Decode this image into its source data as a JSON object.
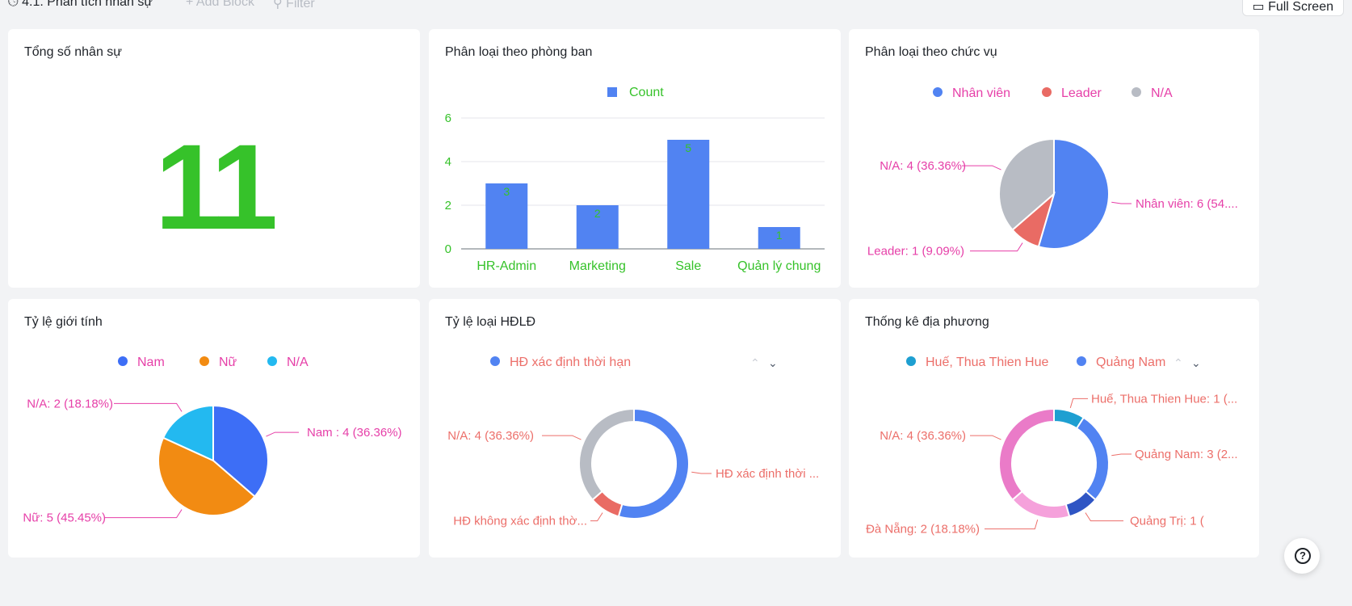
{
  "topbar": {
    "title": "4.1. Phân tích nhân sự",
    "add_block": "+ Add Block",
    "filter": "Filter",
    "full_screen": "Full Screen"
  },
  "cards": {
    "total": {
      "title": "Tổng số nhân sự",
      "value": "11"
    },
    "department": {
      "title": "Phân loại theo phòng ban"
    },
    "position": {
      "title": "Phân loại theo chức vụ"
    },
    "gender": {
      "title": "Tỷ lệ giới tính"
    },
    "contract": {
      "title": "Tỷ lệ loại HĐLĐ"
    },
    "region": {
      "title": "Thống kê địa phương"
    }
  },
  "chart_data": [
    {
      "type": "bar",
      "categories": [
        "HR-Admin",
        "Marketing",
        "Sale",
        "Quản lý chung"
      ],
      "series": [
        {
          "name": "Count",
          "values": [
            3,
            2,
            5,
            1
          ]
        }
      ],
      "ylim": [
        0,
        6
      ],
      "yticks": [
        0,
        2,
        4,
        6
      ],
      "legend": "top",
      "color": "#5183f2"
    },
    {
      "type": "pie",
      "legend": [
        "Nhân viên",
        "Leader",
        "N/A"
      ],
      "slices": [
        {
          "name": "Nhân viên",
          "value": 6,
          "label": "Nhân viên: 6 (54....",
          "color": "#5183f2"
        },
        {
          "name": "Leader",
          "value": 1,
          "label": "Leader: 1 (9.09%)",
          "color": "#e96b64"
        },
        {
          "name": "N/A",
          "value": 4,
          "label": "N/A: 4 (36.36%)",
          "color": "#b8bcc4"
        }
      ]
    },
    {
      "type": "pie",
      "legend": [
        "Nam",
        "Nữ",
        "N/A"
      ],
      "slices": [
        {
          "name": "Nam",
          "value": 4,
          "label": "Nam : 4 (36.36%)",
          "color": "#3d6ef6"
        },
        {
          "name": "Nữ",
          "value": 5,
          "label": "Nữ: 5 (45.45%)",
          "color": "#f28b12"
        },
        {
          "name": "N/A",
          "value": 2,
          "label": "N/A: 2 (18.18%)",
          "color": "#23b9f0"
        }
      ]
    },
    {
      "type": "pie",
      "donut": true,
      "legend": [
        "HĐ xác định thời hạn"
      ],
      "slices": [
        {
          "name": "HĐ xác định thời hạn",
          "value": 6,
          "label": "HĐ xác định thời ...",
          "color": "#5183f2"
        },
        {
          "name": "HĐ không xác định thời hạn",
          "value": 1,
          "label": "HĐ không xác định thờ...",
          "color": "#e96b64"
        },
        {
          "name": "N/A",
          "value": 4,
          "label": "N/A: 4 (36.36%)",
          "color": "#b8bcc4"
        }
      ]
    },
    {
      "type": "pie",
      "donut": true,
      "legend": [
        "Huế, Thua Thien Hue",
        "Quảng Nam"
      ],
      "slices": [
        {
          "name": "Huế, Thua Thien Hue",
          "value": 1,
          "label": "Huế, Thua Thien Hue: 1 (...",
          "color": "#1e9fd1"
        },
        {
          "name": "Quảng Nam",
          "value": 3,
          "label": "Quảng Nam: 3 (2...",
          "color": "#5183f2"
        },
        {
          "name": "Quảng Trị",
          "value": 1,
          "label": "Quảng Trị: 1 (",
          "color": "#2f55c4"
        },
        {
          "name": "Đà Nẵng",
          "value": 2,
          "label": "Đà Nẵng: 2 (18.18%)",
          "color": "#f5a1db"
        },
        {
          "name": "N/A",
          "value": 4,
          "label": "N/A: 4 (36.36%)",
          "color": "#ea7bc8"
        }
      ]
    }
  ],
  "colors": {
    "green": "#36c22a",
    "pink_label": "#e63fa8",
    "salmon_label": "#ec6f6a"
  },
  "icons": {
    "history": "history-icon",
    "monitor": "monitor-icon",
    "help": "help-icon",
    "funnel": "filter-icon"
  }
}
